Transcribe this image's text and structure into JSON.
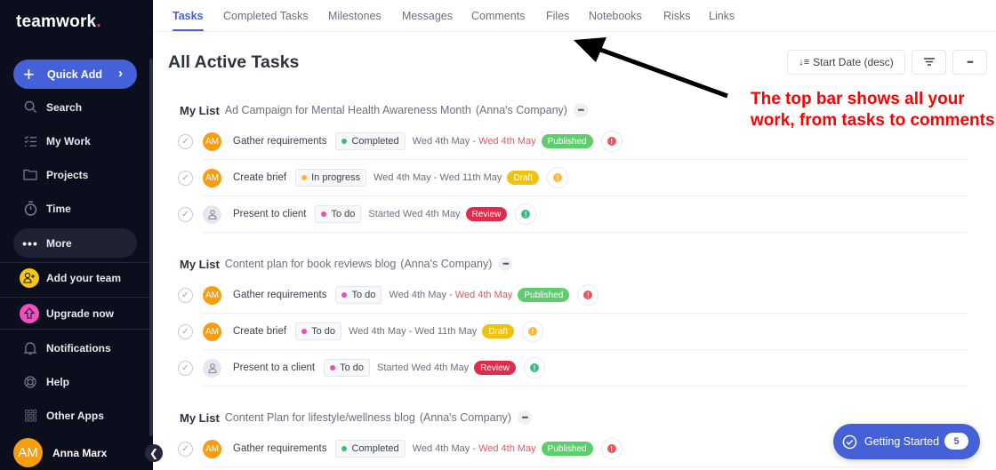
{
  "sidebar": {
    "logo": "teamwork",
    "quick_add": "Quick Add",
    "items": [
      {
        "label": "Search",
        "icon": "search-icon"
      },
      {
        "label": "My Work",
        "icon": "list-check-icon"
      },
      {
        "label": "Projects",
        "icon": "folder-icon"
      },
      {
        "label": "Time",
        "icon": "stopwatch-icon"
      },
      {
        "label": "More",
        "icon": "ellipsis-icon"
      },
      {
        "label": "Add your team",
        "icon": "add-user-icon"
      },
      {
        "label": "Upgrade now",
        "icon": "upgrade-arrow-icon"
      },
      {
        "label": "Notifications",
        "icon": "bell-icon"
      },
      {
        "label": "Help",
        "icon": "lifebuoy-icon"
      },
      {
        "label": "Other Apps",
        "icon": "apps-grid-icon"
      }
    ],
    "user": {
      "initials": "AM",
      "name": "Anna Marx"
    }
  },
  "tabs": [
    "Tasks",
    "Completed Tasks",
    "Milestones",
    "Messages",
    "Comments",
    "Files",
    "Notebooks",
    "Risks",
    "Links"
  ],
  "active_tab": "Tasks",
  "page_title": "All Active Tasks",
  "toolbar": {
    "sort_label": "Start Date (desc)",
    "filter_icon": "filter-icon",
    "more_icon": "ellipsis-icon"
  },
  "lists": [
    {
      "list_label": "My List",
      "project": "Ad Campaign for Mental Health Awareness Month",
      "company": "(Anna's Company)",
      "tasks": [
        {
          "assignee": "AM",
          "name": "Gather requirements",
          "status": "Completed",
          "status_color": "#3dbd7d",
          "start": "Wed 4th May",
          "sep": " - ",
          "due": "Wed 4th May",
          "overdue": true,
          "tag": "Published",
          "tag_color": "#5ccf6c",
          "priority_color": "#e2585f"
        },
        {
          "assignee": "AM",
          "name": "Create brief",
          "status": "In progress",
          "status_color": "#ffb73a",
          "start": "Wed 4th May",
          "sep": " - ",
          "due": "Wed 11th May",
          "overdue": false,
          "tag": "Draft",
          "tag_color": "#f0c20c",
          "priority_color": "#ffb73a"
        },
        {
          "assignee": "",
          "name": "Present to client",
          "status": "To do",
          "status_color": "#e84fb6",
          "start": "Started Wed 4th May",
          "sep": "",
          "due": "",
          "overdue": false,
          "tag": "Review",
          "tag_color": "#e12b4a",
          "priority_color": "#3dbd7d"
        }
      ]
    },
    {
      "list_label": "My List",
      "project": "Content plan for book reviews blog",
      "company": "(Anna's Company)",
      "tasks": [
        {
          "assignee": "AM",
          "name": "Gather requirements",
          "status": "To do",
          "status_color": "#e84fb6",
          "start": "Wed 4th May",
          "sep": " - ",
          "due": "Wed 4th May",
          "overdue": true,
          "tag": "Published",
          "tag_color": "#5ccf6c",
          "priority_color": "#e2585f"
        },
        {
          "assignee": "AM",
          "name": "Create brief",
          "status": "To do",
          "status_color": "#e84fb6",
          "start": "Wed 4th May",
          "sep": " - ",
          "due": "Wed 11th May",
          "overdue": false,
          "tag": "Draft",
          "tag_color": "#f0c20c",
          "priority_color": "#ffb73a"
        },
        {
          "assignee": "",
          "name": "Present to a client",
          "status": "To do",
          "status_color": "#e84fb6",
          "start": "Started Wed 4th May",
          "sep": "",
          "due": "",
          "overdue": false,
          "tag": "Review",
          "tag_color": "#e12b4a",
          "priority_color": "#3dbd7d"
        }
      ]
    },
    {
      "list_label": "My List",
      "project": "Content Plan for lifestyle/wellness blog",
      "company": "(Anna's Company)",
      "tasks": [
        {
          "assignee": "AM",
          "name": "Gather requirements",
          "status": "Completed",
          "status_color": "#3dbd7d",
          "start": "Wed 4th May",
          "sep": " - ",
          "due": "Wed 4th May",
          "overdue": true,
          "tag": "Published",
          "tag_color": "#5ccf6c",
          "priority_color": "#e2585f"
        }
      ]
    }
  ],
  "annotation": "The top bar shows all your work, from tasks to comments",
  "getting_started": {
    "label": "Getting Started",
    "count": "5"
  },
  "colors": {
    "accent": "#4461d7",
    "sidebar_bg": "#0b0e1c",
    "logo_dot": "#ff22a3",
    "annotation": "#ff0000"
  }
}
